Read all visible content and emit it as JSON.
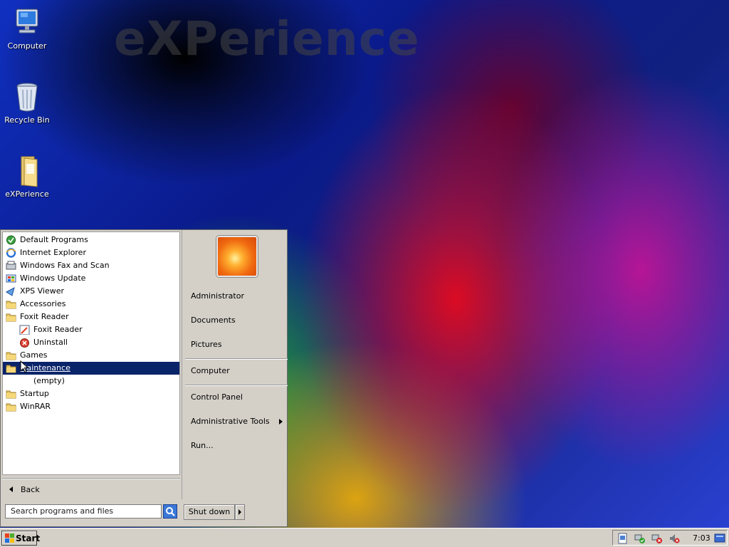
{
  "wallpaper": {
    "title": "eXPerience"
  },
  "desktop_icons": [
    {
      "label": "Computer",
      "icon": "computer-icon"
    },
    {
      "label": "Recycle Bin",
      "icon": "recycle-bin-icon"
    },
    {
      "label": "eXPerience",
      "icon": "folder-icon"
    }
  ],
  "start_menu": {
    "programs": [
      {
        "label": "Default Programs",
        "icon": "default-programs-icon",
        "level": 0
      },
      {
        "label": "Internet Explorer",
        "icon": "internet-explorer-icon",
        "level": 0
      },
      {
        "label": "Windows Fax and Scan",
        "icon": "fax-scan-icon",
        "level": 0
      },
      {
        "label": "Windows Update",
        "icon": "windows-update-icon",
        "level": 0
      },
      {
        "label": "XPS Viewer",
        "icon": "xps-viewer-icon",
        "level": 0
      },
      {
        "label": "Accessories",
        "icon": "folder-icon",
        "level": 0
      },
      {
        "label": "Foxit Reader",
        "icon": "folder-icon",
        "level": 0
      },
      {
        "label": "Foxit Reader",
        "icon": "foxit-reader-icon",
        "level": 1
      },
      {
        "label": "Uninstall",
        "icon": "uninstall-icon",
        "level": 1
      },
      {
        "label": "Games",
        "icon": "folder-icon",
        "level": 0
      },
      {
        "label": "Maintenance",
        "icon": "folder-icon",
        "level": 0,
        "selected": true
      },
      {
        "label": "(empty)",
        "icon": "",
        "level": 1
      },
      {
        "label": "Startup",
        "icon": "folder-icon",
        "level": 0
      },
      {
        "label": "WinRAR",
        "icon": "folder-icon",
        "level": 0
      }
    ],
    "back_label": "Back",
    "search_placeholder": "Search programs and files",
    "right_items": {
      "user": "Administrator",
      "documents": "Documents",
      "pictures": "Pictures",
      "computer": "Computer",
      "control_panel": "Control Panel",
      "admin_tools": "Administrative Tools",
      "run": "Run..."
    },
    "shutdown_label": "Shut down"
  },
  "taskbar": {
    "start_label": "Start",
    "clock": "7:03",
    "tray_icons": [
      "action-center-icon",
      "network-icon",
      "network-disconnected-icon",
      "volume-muted-icon",
      "show-desktop-icon"
    ]
  },
  "colors": {
    "selection": "#0a246a",
    "chrome": "#d4d0c8"
  }
}
